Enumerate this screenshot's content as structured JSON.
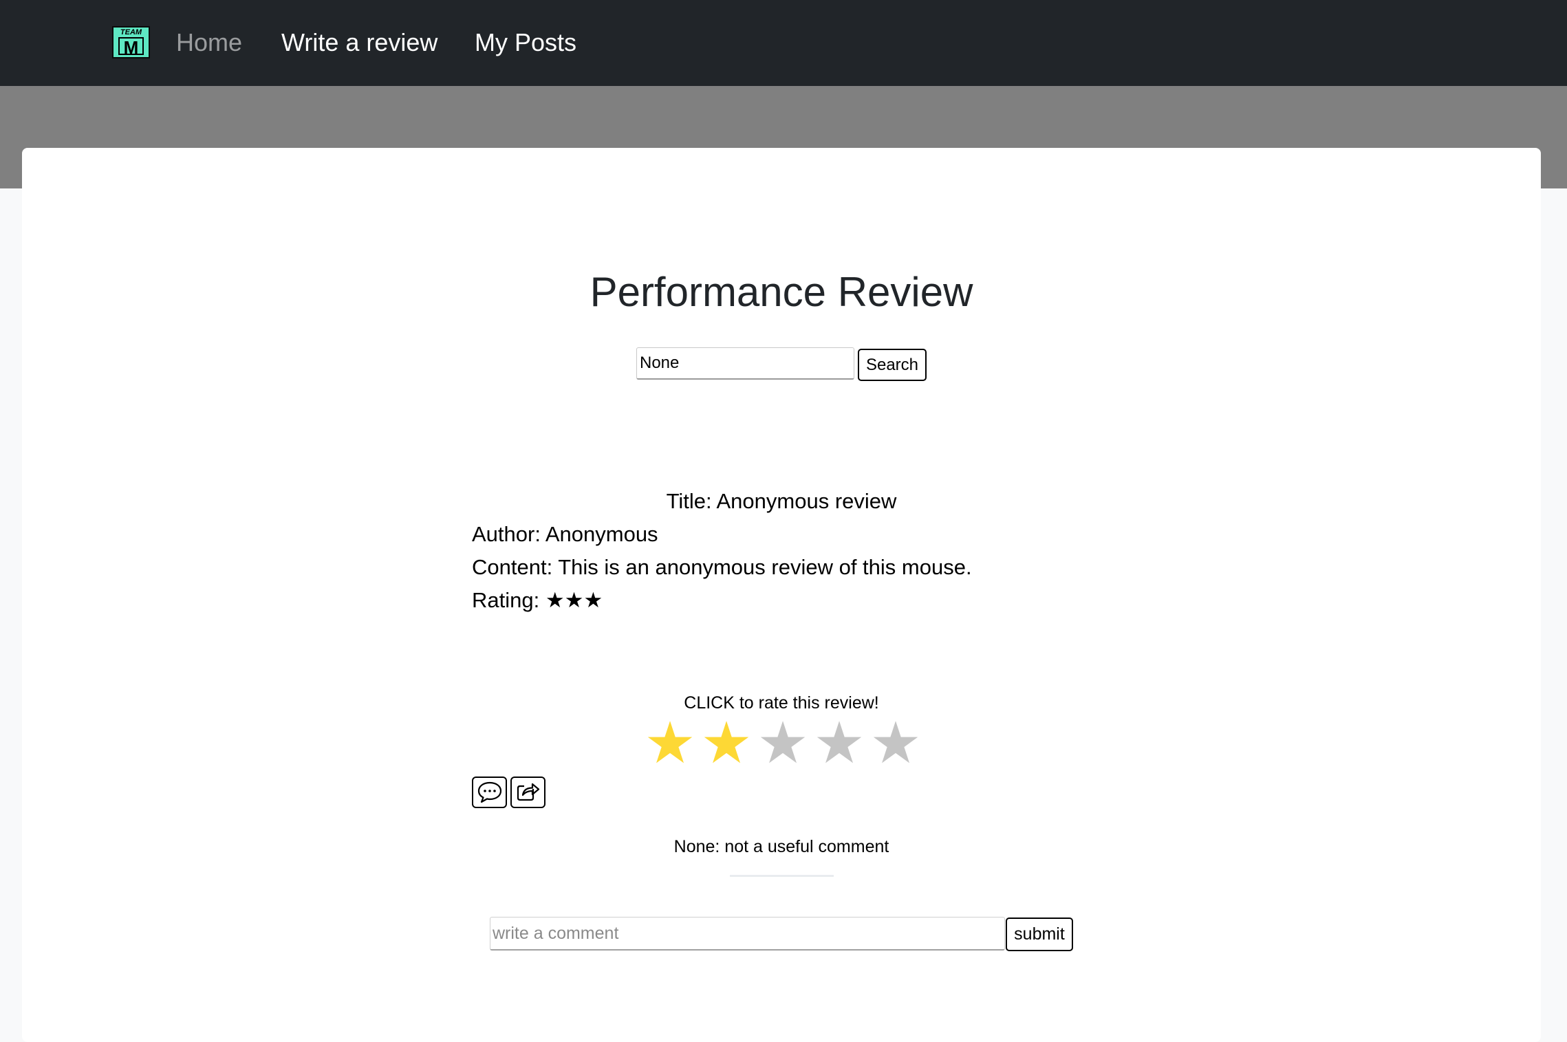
{
  "navbar": {
    "logo": {
      "top_text": "TEAM",
      "letter": "M",
      "color": "#5ee8c3"
    },
    "links": [
      {
        "label": "Home"
      },
      {
        "label": "Write a review"
      },
      {
        "label": "My Posts"
      }
    ]
  },
  "main": {
    "title": "Performance Review",
    "search": {
      "value": "None",
      "button_label": "Search"
    }
  },
  "review": {
    "title_line": "Title: Anonymous review",
    "author_line": "Author: Anonymous",
    "content_line": "Content: This is an anonymous review of this mouse.",
    "rating_label": "Rating:",
    "rating_stars": "★★★",
    "rating_value": 3
  },
  "rate_widget": {
    "prompt": "CLICK to rate this review!",
    "max": 5,
    "current": 2,
    "star_glyph": "★",
    "filled_color": "#fdd835",
    "empty_color": "#c4c4c4"
  },
  "actions": {
    "comment_icon": "chat-bubble-icon",
    "share_icon": "share-icon"
  },
  "comments": [
    {
      "text": "None: not a useful comment"
    }
  ],
  "comment_form": {
    "placeholder": "write a comment",
    "submit_label": "submit"
  }
}
